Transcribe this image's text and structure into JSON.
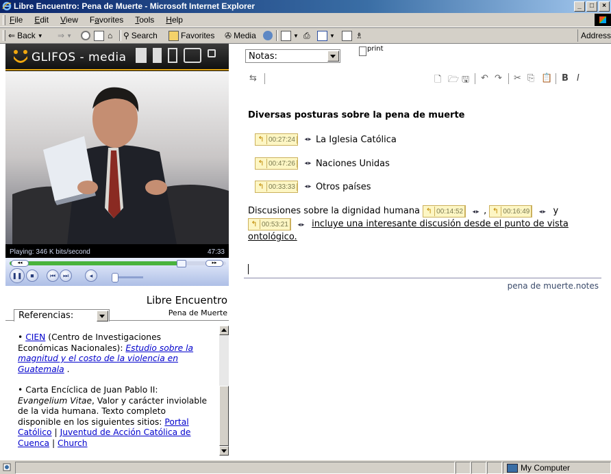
{
  "window": {
    "title": "Libre Encuentro: Pena de Muerte - Microsoft Internet Explorer",
    "controls": [
      "_",
      "□",
      "×"
    ]
  },
  "menubar": {
    "items": [
      {
        "label": "File",
        "u": "F",
        "rest": "ile"
      },
      {
        "label": "Edit",
        "u": "E",
        "rest": "dit"
      },
      {
        "label": "View",
        "u": "V",
        "rest": "iew"
      },
      {
        "label": "Favorites",
        "u": "a",
        "pre": "F",
        "rest": "vorites"
      },
      {
        "label": "Tools",
        "u": "T",
        "rest": "ools"
      },
      {
        "label": "Help",
        "u": "H",
        "rest": "elp"
      }
    ]
  },
  "toolbar": {
    "back": "Back",
    "search": "Search",
    "favorites": "Favorites",
    "media": "Media",
    "address_label": "Address"
  },
  "media_panel": {
    "logo_text": "GLIFOS - media",
    "status_text": "Playing: 346 K bits/second",
    "time_text": "47:33",
    "seek_progress": 0.79
  },
  "references": {
    "title": "Libre Encuentro",
    "subtitle": "Pena de Muerte",
    "tab_label": "Referencias:",
    "item1": {
      "bullet": "•",
      "link": "CIEN",
      "text": "(Centro de Investigaciones Económicas Nacionales):",
      "italic_link": "Estudio sobre la magnitud y el costo de la violencia en Guatemala",
      "end": "."
    },
    "item2": {
      "bullet": "•",
      "text1": "Carta Encíclica de Juan Pablo II:",
      "italic": "Evangelium Vitae",
      "text2": ", Valor y carácter inviolable de la vida humana. Texto completo disponible en los siguientes sitios:",
      "link1": "Portal Católico",
      "sep1": "|",
      "link2": "Juventud de Acción Católica de Cuenca",
      "sep2": "|",
      "link3": "Church"
    }
  },
  "notes": {
    "select_label": "Notas:",
    "print_label": "print",
    "title": "Diversas posturas sobre la pena de muerte",
    "entries": [
      {
        "time": "00:27:24",
        "label": "La Iglesia Católica"
      },
      {
        "time": "00:47:26",
        "label": "Naciones Unidas"
      },
      {
        "time": "00:33:33",
        "label": "Otros países"
      }
    ],
    "discussion": {
      "prefix": "Discusiones sobre la dignidad humana",
      "t1": "00:14:52",
      "comma": ",",
      "t2": "00:16:49",
      "and": "y",
      "t3": "00:53:21",
      "link": "incluye una interesante discusión desde el punto de vista ontológico."
    },
    "filename": "pena de muerte.notes",
    "nav_glyph": "◂ ▸",
    "tc_glyph": "↰"
  },
  "statusbar": {
    "zone": "My Computer"
  },
  "colors": {
    "titlebar": "#0a246a",
    "accent_orange": "#e2a30d",
    "timecode_bg": "#fdf6c4",
    "link": "#0000cc"
  }
}
